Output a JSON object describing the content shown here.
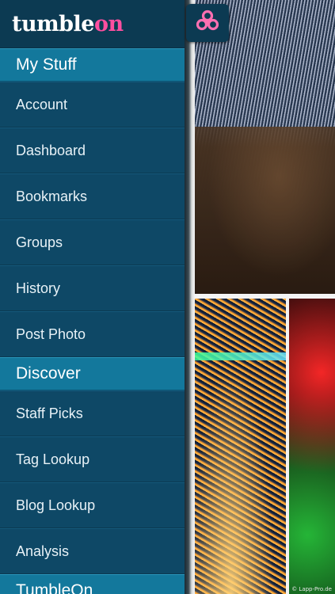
{
  "app": {
    "logo_part1": "tumble",
    "logo_part2": "on"
  },
  "sidebar": {
    "sections": [
      {
        "header": "My Stuff",
        "items": [
          "Account",
          "Dashboard",
          "Bookmarks",
          "Groups",
          "History",
          "Post Photo"
        ]
      },
      {
        "header": "Discover",
        "items": [
          "Staff Picks",
          "Tag Lookup",
          "Blog Lookup",
          "Analysis"
        ]
      },
      {
        "header": "TumbleOn",
        "items": []
      }
    ]
  },
  "photos": {
    "watermark": "© Lapp-Pro.de"
  },
  "colors": {
    "sidebar_bg": "#0e4866",
    "section_header_bg": "#13789c",
    "brand_bg": "#0c3a52",
    "logo_accent": "#ff4fa0"
  },
  "icons": {
    "app_button": "flower-icon"
  }
}
